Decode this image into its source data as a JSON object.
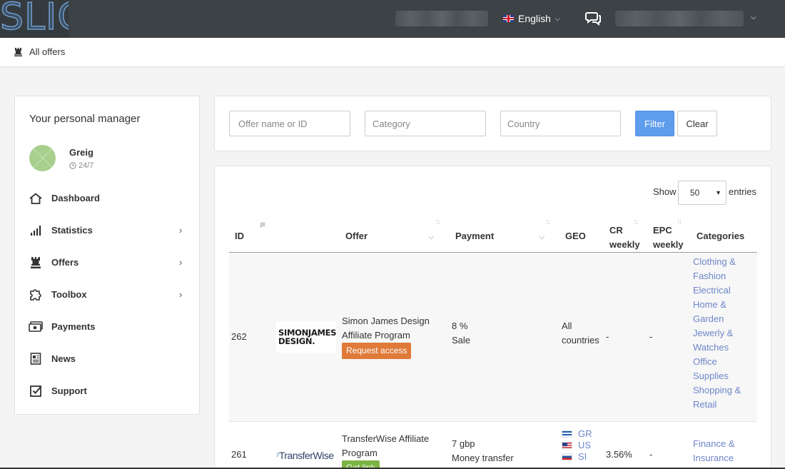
{
  "topbar": {
    "logo_text": "SLICE",
    "language": "English"
  },
  "breadcrumb": {
    "label": "All offers"
  },
  "manager": {
    "title": "Your personal manager",
    "name": "Greig",
    "availability": "24/7"
  },
  "sidebar": {
    "items": [
      {
        "label": "Dashboard",
        "icon": "home-icon",
        "has_submenu": false
      },
      {
        "label": "Statistics",
        "icon": "bar-chart-icon",
        "has_submenu": true
      },
      {
        "label": "Offers",
        "icon": "chess-rook-icon",
        "has_submenu": true
      },
      {
        "label": "Toolbox",
        "icon": "puzzle-icon",
        "has_submenu": true
      },
      {
        "label": "Payments",
        "icon": "money-icon",
        "has_submenu": false
      },
      {
        "label": "News",
        "icon": "newspaper-icon",
        "has_submenu": false
      },
      {
        "label": "Support",
        "icon": "checkbox-icon",
        "has_submenu": false
      }
    ]
  },
  "filters": {
    "offer_placeholder": "Offer name or ID",
    "category_placeholder": "Category",
    "country_placeholder": "Country",
    "filter_label": "Filter",
    "clear_label": "Clear"
  },
  "table": {
    "show_label": "Show",
    "entries_value": "50",
    "entries_label": "entries",
    "columns": {
      "id": "ID",
      "offer": "Offer",
      "payment": "Payment",
      "geo": "GEO",
      "cr_line1": "CR",
      "cr_line2": "weekly",
      "epc_line1": "EPC",
      "epc_line2": "weekly",
      "categories": "Categories"
    },
    "rows": [
      {
        "id": "262",
        "logo_line1": "SIMONJAMES",
        "logo_line2": "DESIGN.",
        "offer_line1": "Simon James Design",
        "offer_line2": "Affiliate Program",
        "action": "Request access",
        "payment_line1": "8 %",
        "payment_line2": "Sale",
        "geo_line1": "All",
        "geo_line2": "countries",
        "cr": "-",
        "epc": "-",
        "categories": [
          "Clothing &",
          "Fashion",
          "Electrical",
          "Home &",
          "Garden",
          "Jewerly &",
          "Watches",
          "Office",
          "Supplies",
          "Shopping &",
          "Retail"
        ]
      },
      {
        "id": "261",
        "logo_text": "TransferWise",
        "offer_line1": "TransferWise Affiliate",
        "offer_line2": "Program",
        "action": "Get link",
        "payment_line1": "7 gbp",
        "payment_line2": "Money transfer",
        "geo": [
          "GR",
          "US",
          "SI"
        ],
        "cr": "3.56%",
        "epc": "-",
        "categories": [
          "Finance &",
          "Insurance"
        ]
      }
    ]
  },
  "colors": {
    "topbar": "#3d4246",
    "filter_button": "#5e9cec",
    "request_button": "#e07a39",
    "get_link_button": "#7cb342",
    "link": "#6d86c9"
  }
}
